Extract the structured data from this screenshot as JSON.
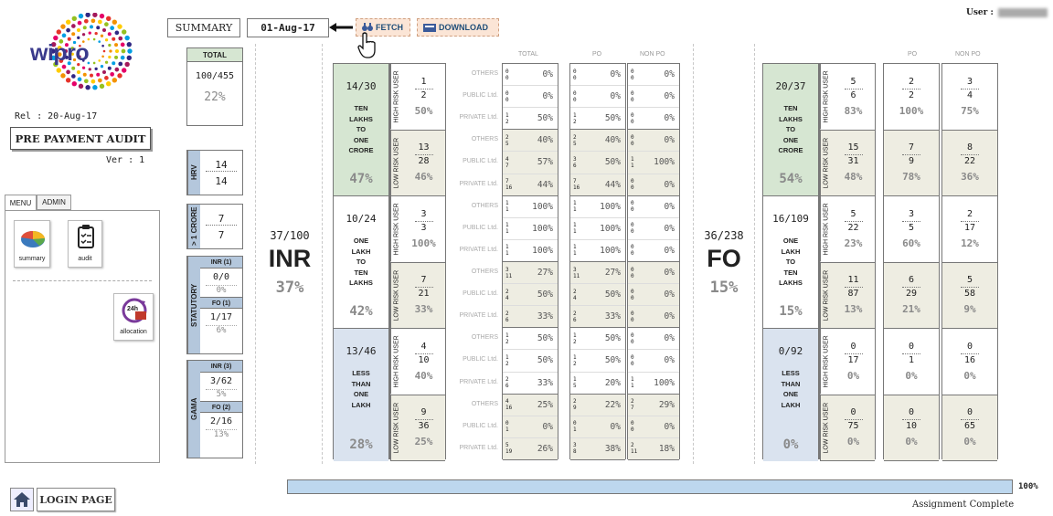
{
  "header": {
    "summary_label": "SUMMARY",
    "date": "01-Aug-17",
    "fetch_label": "FETCH",
    "download_label": "DOWNLOAD",
    "user_label": "User :"
  },
  "left": {
    "logo": "wipro",
    "rel": "Rel : 20-Aug-17",
    "app_title": "PRE PAYMENT AUDIT",
    "ver": "Ver :  1",
    "tabs": [
      "MENU",
      "ADMIN"
    ],
    "summary_icon": "summary",
    "audit_icon": "audit",
    "allocation_icon": "allocation",
    "allocation_badge": "24h",
    "login": "LOGIN PAGE"
  },
  "stats": {
    "total_label": "TOTAL",
    "total_val": "100/455",
    "total_pct": "22%",
    "hrv_label": "HRV",
    "hrv_a": "14",
    "hrv_b": "14",
    "crore_label": "> 1 CRORE",
    "crore_a": "7",
    "crore_b": "7",
    "stat_label": "STATUTORY",
    "inr1": "INR (1)",
    "inr1_val": "0/0",
    "inr1_pct": "0%",
    "fo1": "FO (1)",
    "fo1_val": "1/17",
    "fo1_pct": "6%",
    "gama_label": "GAMA",
    "inr3": "INR (3)",
    "inr3_val": "3/62",
    "inr3_pct": "5%",
    "fo2": "FO (2)",
    "fo2_val": "2/16",
    "fo2_pct": "13%"
  },
  "inr": {
    "frac": "37/100",
    "label": "INR",
    "pct": "37%"
  },
  "fo": {
    "frac": "36/238",
    "label": "FO",
    "pct": "15%"
  },
  "col_headers": {
    "total": "TOTAL",
    "po": "PO",
    "nonpo": "NON PO"
  },
  "bands_inr": [
    {
      "frac": "14/30",
      "label": [
        "TEN",
        "LAKHS",
        "TO",
        "ONE",
        "CRORE"
      ],
      "pct": "47%",
      "hi": {
        "a": "1",
        "b": "2",
        "p": "50%"
      },
      "lo": {
        "a": "13",
        "b": "28",
        "p": "46%"
      }
    },
    {
      "frac": "10/24",
      "label": [
        "ONE",
        "LAKH",
        "TO",
        "TEN",
        "LAKHS"
      ],
      "pct": "42%",
      "hi": {
        "a": "3",
        "b": "3",
        "p": "100%"
      },
      "lo": {
        "a": "7",
        "b": "21",
        "p": "33%"
      }
    },
    {
      "frac": "13/46",
      "label": [
        "LESS",
        "THAN",
        "ONE",
        "LAKH"
      ],
      "pct": "28%",
      "hi": {
        "a": "4",
        "b": "10",
        "p": "40%"
      },
      "lo": {
        "a": "9",
        "b": "36",
        "p": "25%"
      }
    }
  ],
  "risk_labels": {
    "hi": "HIGH RISK USER",
    "lo": "LOW RISK USER"
  },
  "row_types": [
    "OTHERS",
    "PUBLIC Ltd.",
    "PRIVATE Ltd."
  ],
  "inr_rows": [
    [
      [
        "0",
        "0",
        "0%"
      ],
      [
        "0",
        "0",
        "0%"
      ],
      [
        "0",
        "0",
        "0%"
      ]
    ],
    [
      [
        "0",
        "0",
        "0%"
      ],
      [
        "0",
        "0",
        "0%"
      ],
      [
        "0",
        "0",
        "0%"
      ]
    ],
    [
      [
        "1",
        "2",
        "50%"
      ],
      [
        "1",
        "2",
        "50%"
      ],
      [
        "0",
        "0",
        "0%"
      ]
    ],
    [
      [
        "2",
        "5",
        "40%"
      ],
      [
        "2",
        "5",
        "40%"
      ],
      [
        "0",
        "0",
        "0%"
      ]
    ],
    [
      [
        "4",
        "7",
        "57%"
      ],
      [
        "3",
        "6",
        "50%"
      ],
      [
        "1",
        "1",
        "100%"
      ]
    ],
    [
      [
        "7",
        "16",
        "44%"
      ],
      [
        "7",
        "16",
        "44%"
      ],
      [
        "0",
        "0",
        "0%"
      ]
    ],
    [
      [
        "1",
        "1",
        "100%"
      ],
      [
        "1",
        "1",
        "100%"
      ],
      [
        "0",
        "0",
        "0%"
      ]
    ],
    [
      [
        "1",
        "1",
        "100%"
      ],
      [
        "1",
        "1",
        "100%"
      ],
      [
        "0",
        "0",
        "0%"
      ]
    ],
    [
      [
        "1",
        "1",
        "100%"
      ],
      [
        "1",
        "1",
        "100%"
      ],
      [
        "0",
        "0",
        "0%"
      ]
    ],
    [
      [
        "3",
        "11",
        "27%"
      ],
      [
        "3",
        "11",
        "27%"
      ],
      [
        "0",
        "0",
        "0%"
      ]
    ],
    [
      [
        "2",
        "4",
        "50%"
      ],
      [
        "2",
        "4",
        "50%"
      ],
      [
        "0",
        "0",
        "0%"
      ]
    ],
    [
      [
        "2",
        "6",
        "33%"
      ],
      [
        "2",
        "6",
        "33%"
      ],
      [
        "0",
        "0",
        "0%"
      ]
    ],
    [
      [
        "1",
        "2",
        "50%"
      ],
      [
        "1",
        "2",
        "50%"
      ],
      [
        "0",
        "0",
        "0%"
      ]
    ],
    [
      [
        "1",
        "2",
        "50%"
      ],
      [
        "1",
        "2",
        "50%"
      ],
      [
        "0",
        "0",
        "0%"
      ]
    ],
    [
      [
        "2",
        "6",
        "33%"
      ],
      [
        "1",
        "5",
        "20%"
      ],
      [
        "1",
        "1",
        "100%"
      ]
    ],
    [
      [
        "4",
        "16",
        "25%"
      ],
      [
        "2",
        "9",
        "22%"
      ],
      [
        "2",
        "7",
        "29%"
      ]
    ],
    [
      [
        "0",
        "1",
        "0%"
      ],
      [
        "0",
        "1",
        "0%"
      ],
      [
        "0",
        "0",
        "0%"
      ]
    ],
    [
      [
        "5",
        "19",
        "26%"
      ],
      [
        "3",
        "8",
        "38%"
      ],
      [
        "2",
        "11",
        "18%"
      ]
    ]
  ],
  "bands_fo": [
    {
      "frac": "20/37",
      "label": [
        "TEN",
        "LAKHS",
        "TO",
        "ONE",
        "CRORE"
      ],
      "pct": "54%",
      "hi": {
        "a": "5",
        "b": "6",
        "p": "83%",
        "po": [
          "2",
          "2",
          "100%"
        ],
        "np": [
          "3",
          "4",
          "75%"
        ]
      },
      "lo": {
        "a": "15",
        "b": "31",
        "p": "48%",
        "po": [
          "7",
          "9",
          "78%"
        ],
        "np": [
          "8",
          "22",
          "36%"
        ]
      }
    },
    {
      "frac": "16/109",
      "label": [
        "ONE",
        "LAKH",
        "TO",
        "TEN",
        "LAKHS"
      ],
      "pct": "15%",
      "hi": {
        "a": "5",
        "b": "22",
        "p": "23%",
        "po": [
          "3",
          "5",
          "60%"
        ],
        "np": [
          "2",
          "17",
          "12%"
        ]
      },
      "lo": {
        "a": "11",
        "b": "87",
        "p": "13%",
        "po": [
          "6",
          "29",
          "21%"
        ],
        "np": [
          "5",
          "58",
          "9%"
        ]
      }
    },
    {
      "frac": "0/92",
      "label": [
        "LESS",
        "THAN",
        "ONE",
        "LAKH"
      ],
      "pct": "0%",
      "hi": {
        "a": "0",
        "b": "17",
        "p": "0%",
        "po": [
          "0",
          "1",
          "0%"
        ],
        "np": [
          "0",
          "16",
          "0%"
        ]
      },
      "lo": {
        "a": "0",
        "b": "75",
        "p": "0%",
        "po": [
          "0",
          "10",
          "0%"
        ],
        "np": [
          "0",
          "65",
          "0%"
        ]
      }
    }
  ],
  "progress": {
    "value": 1.0,
    "pct_label": "100%",
    "status": "Assignment Complete"
  }
}
